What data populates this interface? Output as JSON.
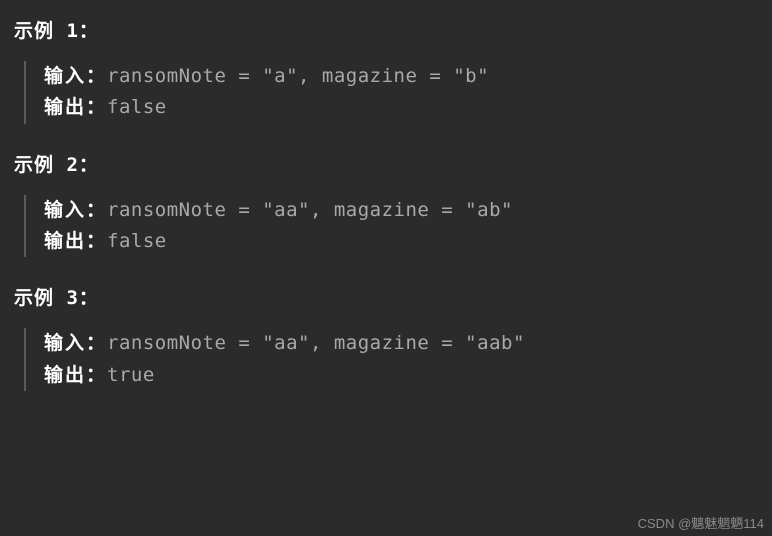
{
  "examples": [
    {
      "title": "示例 1：",
      "input_label": "输入：",
      "input_value": "ransomNote = \"a\", magazine = \"b\"",
      "output_label": "输出：",
      "output_value": "false"
    },
    {
      "title": "示例 2：",
      "input_label": "输入：",
      "input_value": "ransomNote = \"aa\", magazine = \"ab\"",
      "output_label": "输出：",
      "output_value": "false"
    },
    {
      "title": "示例 3：",
      "input_label": "输入：",
      "input_value": "ransomNote = \"aa\", magazine = \"aab\"",
      "output_label": "输出：",
      "output_value": "true"
    }
  ],
  "watermark": "CSDN @魑魅魍魉114"
}
